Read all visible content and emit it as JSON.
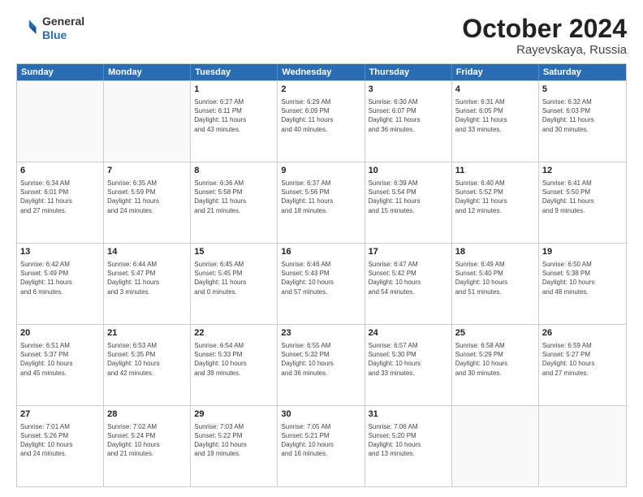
{
  "logo": {
    "general": "General",
    "blue": "Blue"
  },
  "header": {
    "month": "October 2024",
    "location": "Rayevskaya, Russia"
  },
  "weekdays": [
    "Sunday",
    "Monday",
    "Tuesday",
    "Wednesday",
    "Thursday",
    "Friday",
    "Saturday"
  ],
  "rows": [
    [
      {
        "day": "",
        "info": ""
      },
      {
        "day": "",
        "info": ""
      },
      {
        "day": "1",
        "info": "Sunrise: 6:27 AM\nSunset: 6:11 PM\nDaylight: 11 hours\nand 43 minutes."
      },
      {
        "day": "2",
        "info": "Sunrise: 6:29 AM\nSunset: 6:09 PM\nDaylight: 11 hours\nand 40 minutes."
      },
      {
        "day": "3",
        "info": "Sunrise: 6:30 AM\nSunset: 6:07 PM\nDaylight: 11 hours\nand 36 minutes."
      },
      {
        "day": "4",
        "info": "Sunrise: 6:31 AM\nSunset: 6:05 PM\nDaylight: 11 hours\nand 33 minutes."
      },
      {
        "day": "5",
        "info": "Sunrise: 6:32 AM\nSunset: 6:03 PM\nDaylight: 11 hours\nand 30 minutes."
      }
    ],
    [
      {
        "day": "6",
        "info": "Sunrise: 6:34 AM\nSunset: 6:01 PM\nDaylight: 11 hours\nand 27 minutes."
      },
      {
        "day": "7",
        "info": "Sunrise: 6:35 AM\nSunset: 5:59 PM\nDaylight: 11 hours\nand 24 minutes."
      },
      {
        "day": "8",
        "info": "Sunrise: 6:36 AM\nSunset: 5:58 PM\nDaylight: 11 hours\nand 21 minutes."
      },
      {
        "day": "9",
        "info": "Sunrise: 6:37 AM\nSunset: 5:56 PM\nDaylight: 11 hours\nand 18 minutes."
      },
      {
        "day": "10",
        "info": "Sunrise: 6:39 AM\nSunset: 5:54 PM\nDaylight: 11 hours\nand 15 minutes."
      },
      {
        "day": "11",
        "info": "Sunrise: 6:40 AM\nSunset: 5:52 PM\nDaylight: 11 hours\nand 12 minutes."
      },
      {
        "day": "12",
        "info": "Sunrise: 6:41 AM\nSunset: 5:50 PM\nDaylight: 11 hours\nand 9 minutes."
      }
    ],
    [
      {
        "day": "13",
        "info": "Sunrise: 6:42 AM\nSunset: 5:49 PM\nDaylight: 11 hours\nand 6 minutes."
      },
      {
        "day": "14",
        "info": "Sunrise: 6:44 AM\nSunset: 5:47 PM\nDaylight: 11 hours\nand 3 minutes."
      },
      {
        "day": "15",
        "info": "Sunrise: 6:45 AM\nSunset: 5:45 PM\nDaylight: 11 hours\nand 0 minutes."
      },
      {
        "day": "16",
        "info": "Sunrise: 6:46 AM\nSunset: 5:43 PM\nDaylight: 10 hours\nand 57 minutes."
      },
      {
        "day": "17",
        "info": "Sunrise: 6:47 AM\nSunset: 5:42 PM\nDaylight: 10 hours\nand 54 minutes."
      },
      {
        "day": "18",
        "info": "Sunrise: 6:49 AM\nSunset: 5:40 PM\nDaylight: 10 hours\nand 51 minutes."
      },
      {
        "day": "19",
        "info": "Sunrise: 6:50 AM\nSunset: 5:38 PM\nDaylight: 10 hours\nand 48 minutes."
      }
    ],
    [
      {
        "day": "20",
        "info": "Sunrise: 6:51 AM\nSunset: 5:37 PM\nDaylight: 10 hours\nand 45 minutes."
      },
      {
        "day": "21",
        "info": "Sunrise: 6:53 AM\nSunset: 5:35 PM\nDaylight: 10 hours\nand 42 minutes."
      },
      {
        "day": "22",
        "info": "Sunrise: 6:54 AM\nSunset: 5:33 PM\nDaylight: 10 hours\nand 39 minutes."
      },
      {
        "day": "23",
        "info": "Sunrise: 6:55 AM\nSunset: 5:32 PM\nDaylight: 10 hours\nand 36 minutes."
      },
      {
        "day": "24",
        "info": "Sunrise: 6:57 AM\nSunset: 5:30 PM\nDaylight: 10 hours\nand 33 minutes."
      },
      {
        "day": "25",
        "info": "Sunrise: 6:58 AM\nSunset: 5:29 PM\nDaylight: 10 hours\nand 30 minutes."
      },
      {
        "day": "26",
        "info": "Sunrise: 6:59 AM\nSunset: 5:27 PM\nDaylight: 10 hours\nand 27 minutes."
      }
    ],
    [
      {
        "day": "27",
        "info": "Sunrise: 7:01 AM\nSunset: 5:26 PM\nDaylight: 10 hours\nand 24 minutes."
      },
      {
        "day": "28",
        "info": "Sunrise: 7:02 AM\nSunset: 5:24 PM\nDaylight: 10 hours\nand 21 minutes."
      },
      {
        "day": "29",
        "info": "Sunrise: 7:03 AM\nSunset: 5:22 PM\nDaylight: 10 hours\nand 19 minutes."
      },
      {
        "day": "30",
        "info": "Sunrise: 7:05 AM\nSunset: 5:21 PM\nDaylight: 10 hours\nand 16 minutes."
      },
      {
        "day": "31",
        "info": "Sunrise: 7:06 AM\nSunset: 5:20 PM\nDaylight: 10 hours\nand 13 minutes."
      },
      {
        "day": "",
        "info": ""
      },
      {
        "day": "",
        "info": ""
      }
    ]
  ]
}
